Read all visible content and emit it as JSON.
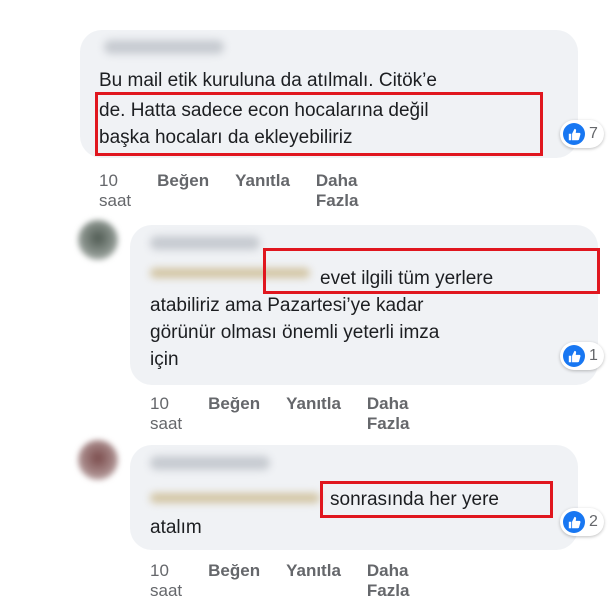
{
  "comments": [
    {
      "lines": [
        "Bu mail etik kuruluna da atılmalı. Citök’e",
        "de. Hatta sadece econ hocalarına değil",
        "başka hocaları da ekleyebiliriz"
      ],
      "reaction_count": "7",
      "time": "10 saat",
      "like": "Beğen",
      "reply": "Yanıtla",
      "more": "Daha Fazla"
    },
    {
      "lines": [
        "evet ilgili tüm yerlere",
        "atabiliriz ama Pazartesi’ye kadar",
        "görünür olması önemli yeterli imza",
        "için"
      ],
      "reaction_count": "1",
      "time": "10 saat",
      "like": "Beğen",
      "reply": "Yanıtla",
      "more": "Daha Fazla"
    },
    {
      "lines": [
        "sonrasında her yere",
        "atalım"
      ],
      "reaction_count": "2",
      "time": "10 saat",
      "like": "Beğen",
      "reply": "Yanıtla",
      "more": "Daha Fazla"
    }
  ],
  "colors": {
    "highlight": "#e0161e",
    "bubble": "#f0f2f5",
    "like_blue": "#1877f2",
    "meta_gray": "#65676b"
  },
  "icons": [
    "thumbs-up-icon"
  ]
}
